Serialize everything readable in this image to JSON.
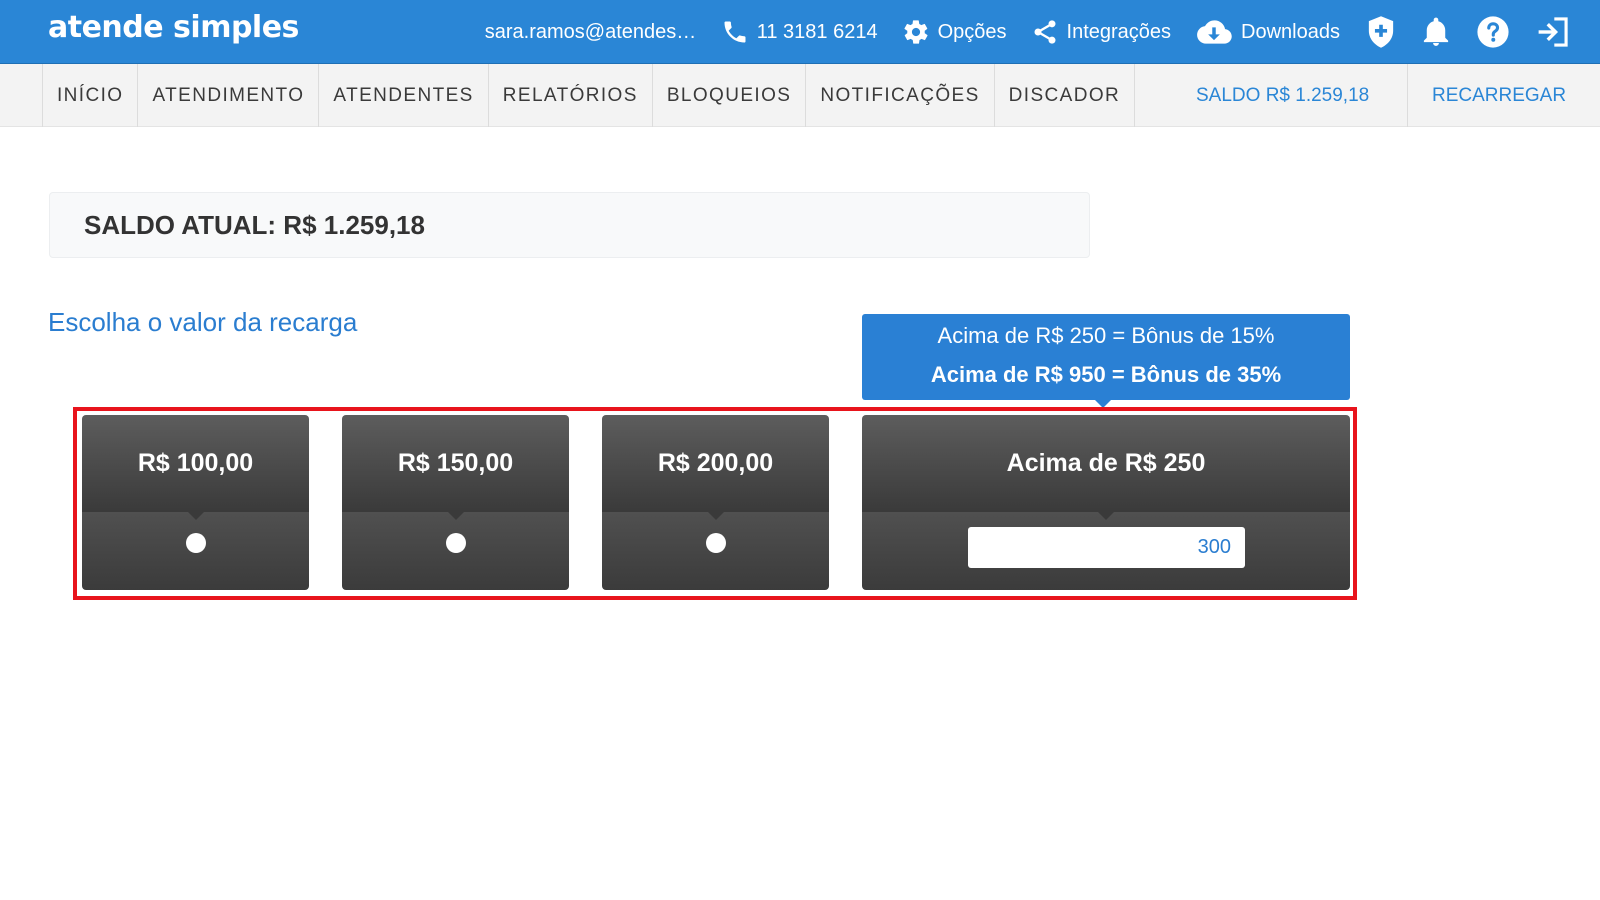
{
  "app": {
    "logo": "atende simples"
  },
  "topbar": {
    "email": "sara.ramos@atendesi...",
    "phone": "11 3181 6214",
    "options_label": "Opções",
    "integrations_label": "Integrações",
    "downloads_label": "Downloads",
    "icons": [
      "phone-icon",
      "gear-icon",
      "share-icon",
      "cloud-download-icon",
      "shield-icon",
      "bell-icon",
      "help-icon",
      "logout-icon"
    ]
  },
  "nav": {
    "items": [
      "INÍCIO",
      "ATENDIMENTO",
      "ATENDENTES",
      "RELATÓRIOS",
      "BLOQUEIOS",
      "NOTIFICAÇÕES",
      "DISCADOR"
    ],
    "saldo": "SALDO R$ 1.259,18",
    "recarregar": "RECARREGAR"
  },
  "main": {
    "saldo_atual": "SALDO ATUAL: R$ 1.259,18",
    "section_title": "Escolha o valor da recarga",
    "tooltip": {
      "line1": "Acima de R$ 250 = Bônus de 15%",
      "line2": "Acima de R$ 950 = Bônus de 35%"
    },
    "options": [
      {
        "label": "R$ 100,00"
      },
      {
        "label": "R$ 150,00"
      },
      {
        "label": "R$ 200,00"
      }
    ],
    "custom_option": {
      "label": "Acima de R$ 250",
      "value": "300"
    }
  },
  "colors": {
    "primary": "#2a86d6",
    "card": "#444444",
    "highlight": "#e8141c"
  }
}
